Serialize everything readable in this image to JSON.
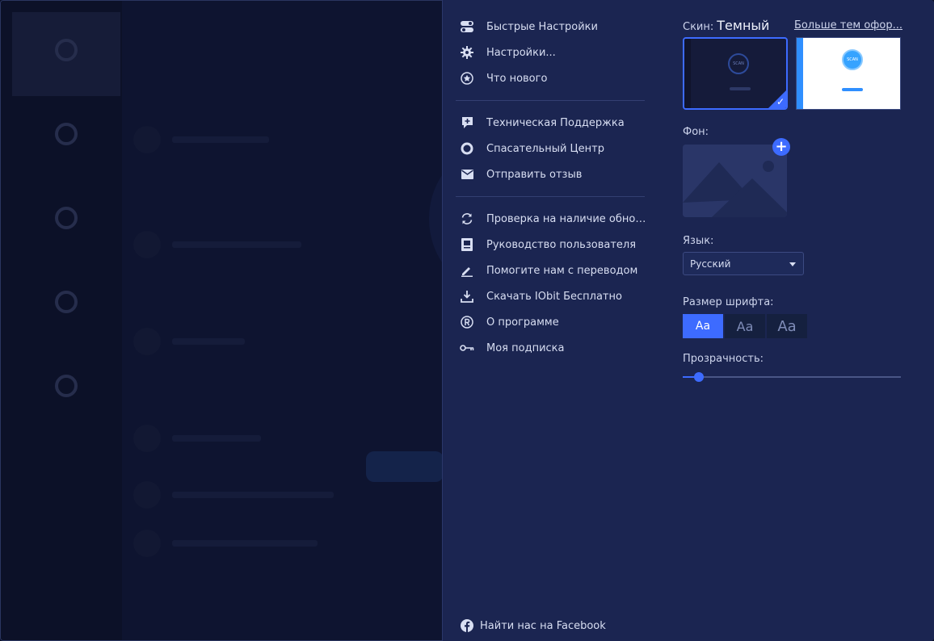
{
  "menu": {
    "group1": [
      {
        "label": "Быстрые Настройки",
        "icon": "toggle-icon"
      },
      {
        "label": "Настройки...",
        "icon": "gear-icon"
      },
      {
        "label": "Что нового",
        "icon": "star-icon"
      }
    ],
    "group2": [
      {
        "label": "Техническая Поддержка",
        "icon": "support-plus-icon"
      },
      {
        "label": "Спасательный Центр",
        "icon": "lifebuoy-icon"
      },
      {
        "label": "Отправить отзыв",
        "icon": "mail-icon"
      }
    ],
    "group3": [
      {
        "label": "Проверка на наличие обновл...",
        "icon": "refresh-icon"
      },
      {
        "label": "Руководство пользователя",
        "icon": "manual-icon"
      },
      {
        "label": "Помогите нам с переводом",
        "icon": "pencil-icon"
      },
      {
        "label": "Скачать IObit Бесплатно",
        "icon": "download-icon"
      },
      {
        "label": "О программе",
        "icon": "registered-icon"
      },
      {
        "label": "Моя подписка",
        "icon": "key-icon"
      }
    ]
  },
  "facebook": {
    "label": "Найти нас на Facebook",
    "icon": "facebook-icon"
  },
  "skin": {
    "label": "Скин:",
    "value": "Темный",
    "more_link": "Больше тем офор...",
    "thumb_text": "SCAN"
  },
  "background": {
    "label": "Фон:",
    "add_symbol": "+"
  },
  "language": {
    "label": "Язык:",
    "selected": "Русский"
  },
  "font_size": {
    "label": "Размер шрифта:",
    "options": [
      "Aa",
      "Aa",
      "Aa"
    ],
    "selected_index": 0
  },
  "transparency": {
    "label": "Прозрачность:",
    "value": 0.05
  },
  "colors": {
    "accent": "#3d6bff",
    "panel_bg": "#1b2551"
  }
}
